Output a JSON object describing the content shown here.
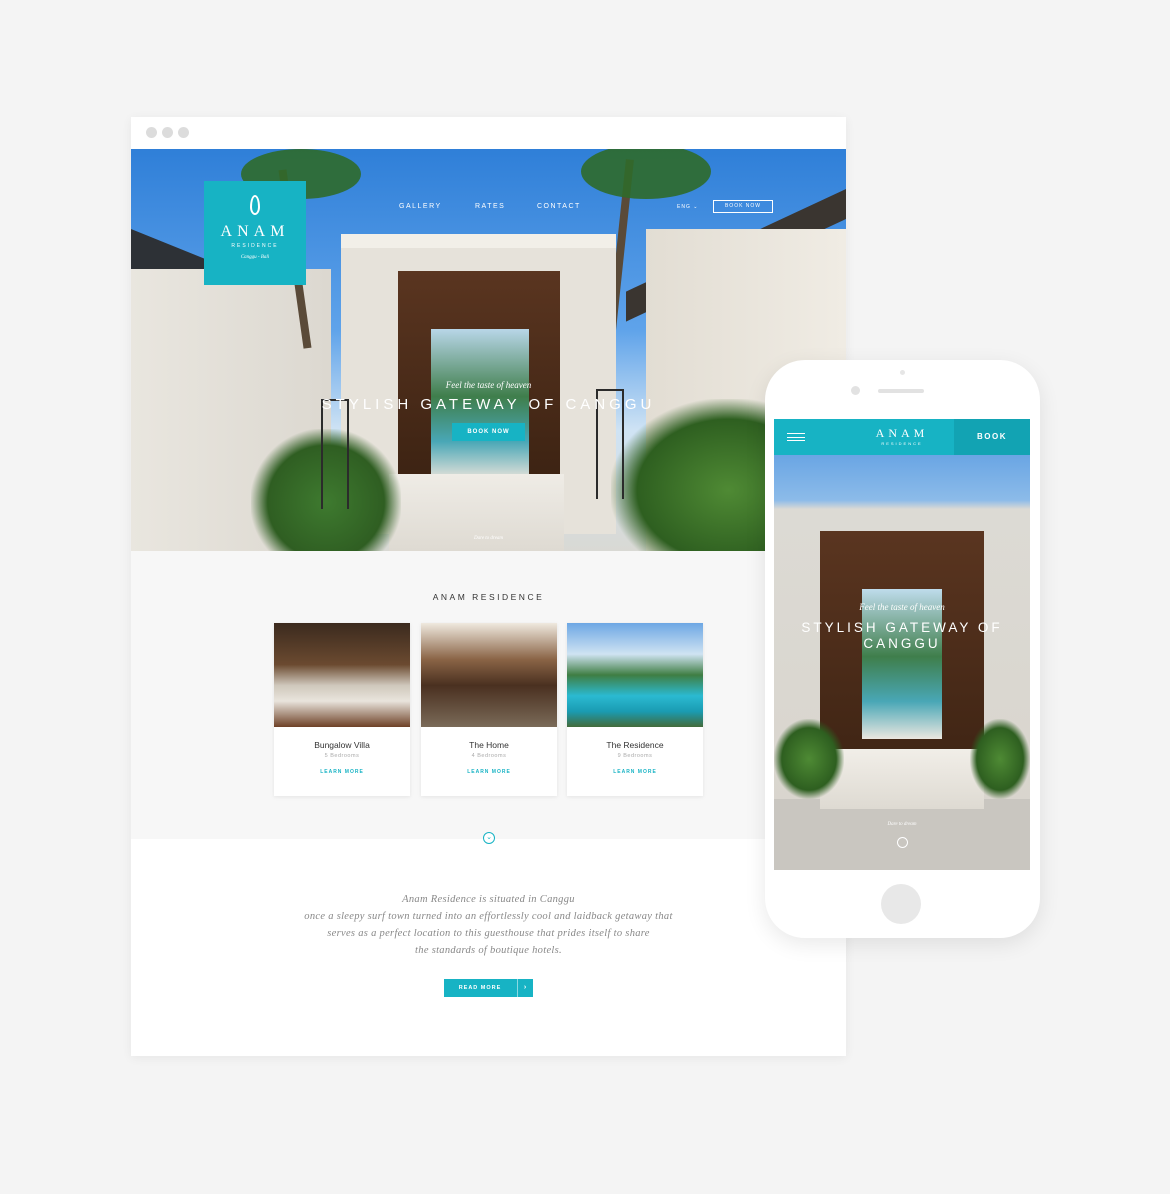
{
  "desktop": {
    "logo": {
      "name": "ANAM",
      "sub": "RESIDENCE",
      "location": "Canggu - Bali"
    },
    "nav": {
      "gallery": "GALLERY",
      "rates": "RATES",
      "contact": "CONTACT",
      "lang": "ENG",
      "book": "BOOK NOW"
    },
    "hero": {
      "tagline": "Feel the taste of heaven",
      "title": "STYLISH GATEWAY OF CANGGU",
      "button": "BOOK NOW",
      "dare": "Dare to dream"
    },
    "section": {
      "title": "ANAM RESIDENCE",
      "cards": [
        {
          "name": "Bungalow Villa",
          "bedrooms": "5 Bedrooms",
          "link": "LEARN MORE"
        },
        {
          "name": "The Home",
          "bedrooms": "4 Bedrooms",
          "link": "LEARN MORE"
        },
        {
          "name": "The Residence",
          "bedrooms": "9 Bedrooms",
          "link": "LEARN MORE"
        }
      ]
    },
    "about": {
      "lines": [
        "Anam Residence is situated in Canggu",
        "once a sleepy surf town turned into an effortlessly cool and laidback getaway that",
        "serves as a perfect location to this guesthouse that prides itself to share",
        "the standards of boutique hotels."
      ],
      "button": "READ MORE",
      "arrow": "›"
    },
    "scroll_icon": "⌄"
  },
  "mobile": {
    "logo": {
      "name": "ANAM",
      "sub": "RESIDENCE"
    },
    "book": "BOOK",
    "tagline": "Feel the taste of heaven",
    "title": "STYLISH GATEWAY OF CANGGU",
    "dare": "Dare to dream"
  },
  "colors": {
    "accent": "#17b3c4",
    "background": "#f4f4f4"
  }
}
